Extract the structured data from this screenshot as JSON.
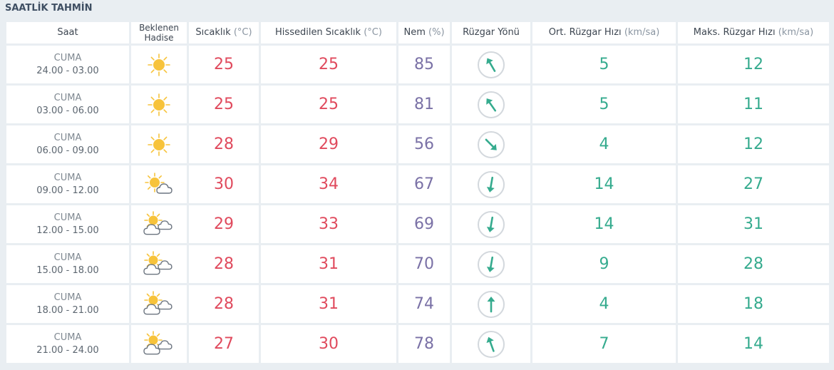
{
  "title": "SAATLİK TAHMİN",
  "headers": {
    "saat": "Saat",
    "hadise": "Beklenen Hadise",
    "sicaklik": "Sıcaklık",
    "sicaklik_unit": "(°C)",
    "hissedilen": "Hissedilen Sıcaklık",
    "hissedilen_unit": "(°C)",
    "nem": "Nem",
    "nem_unit": "(%)",
    "ruzgar_yonu": "Rüzgar Yönü",
    "ort_ruzgar": "Ort. Rüzgar Hızı",
    "ort_ruzgar_unit": "(km/sa)",
    "maks_ruzgar": "Maks. Rüzgar Hızı",
    "maks_ruzgar_unit": "(km/sa)"
  },
  "colors": {
    "temperature": "#e04a5d",
    "humidity": "#7a71a6",
    "wind": "#35ab8e",
    "sun": "#f7c33b"
  },
  "rows": [
    {
      "day": "CUMA",
      "time": "24.00 - 03.00",
      "icon": "sunny-icon",
      "temp": "25",
      "feels": "25",
      "humidity": "85",
      "wind_dir_deg": 330,
      "wind_avg": "5",
      "wind_max": "12"
    },
    {
      "day": "CUMA",
      "time": "03.00 - 06.00",
      "icon": "sunny-icon",
      "temp": "25",
      "feels": "25",
      "humidity": "81",
      "wind_dir_deg": 325,
      "wind_avg": "5",
      "wind_max": "11"
    },
    {
      "day": "CUMA",
      "time": "06.00 - 09.00",
      "icon": "sunny-icon",
      "temp": "28",
      "feels": "29",
      "humidity": "56",
      "wind_dir_deg": 135,
      "wind_avg": "4",
      "wind_max": "12"
    },
    {
      "day": "CUMA",
      "time": "09.00 - 12.00",
      "icon": "partly-cloudy-icon",
      "temp": "30",
      "feels": "34",
      "humidity": "67",
      "wind_dir_deg": 190,
      "wind_avg": "14",
      "wind_max": "27"
    },
    {
      "day": "CUMA",
      "time": "12.00 - 15.00",
      "icon": "mostly-cloudy-icon",
      "temp": "29",
      "feels": "33",
      "humidity": "69",
      "wind_dir_deg": 190,
      "wind_avg": "14",
      "wind_max": "31"
    },
    {
      "day": "CUMA",
      "time": "15.00 - 18.00",
      "icon": "mostly-cloudy-icon",
      "temp": "28",
      "feels": "31",
      "humidity": "70",
      "wind_dir_deg": 190,
      "wind_avg": "9",
      "wind_max": "28"
    },
    {
      "day": "CUMA",
      "time": "18.00 - 21.00",
      "icon": "mostly-cloudy-icon",
      "temp": "28",
      "feels": "31",
      "humidity": "74",
      "wind_dir_deg": 0,
      "wind_avg": "4",
      "wind_max": "18"
    },
    {
      "day": "CUMA",
      "time": "21.00 - 24.00",
      "icon": "mostly-cloudy-icon",
      "temp": "27",
      "feels": "30",
      "humidity": "78",
      "wind_dir_deg": 340,
      "wind_avg": "7",
      "wind_max": "14"
    }
  ]
}
